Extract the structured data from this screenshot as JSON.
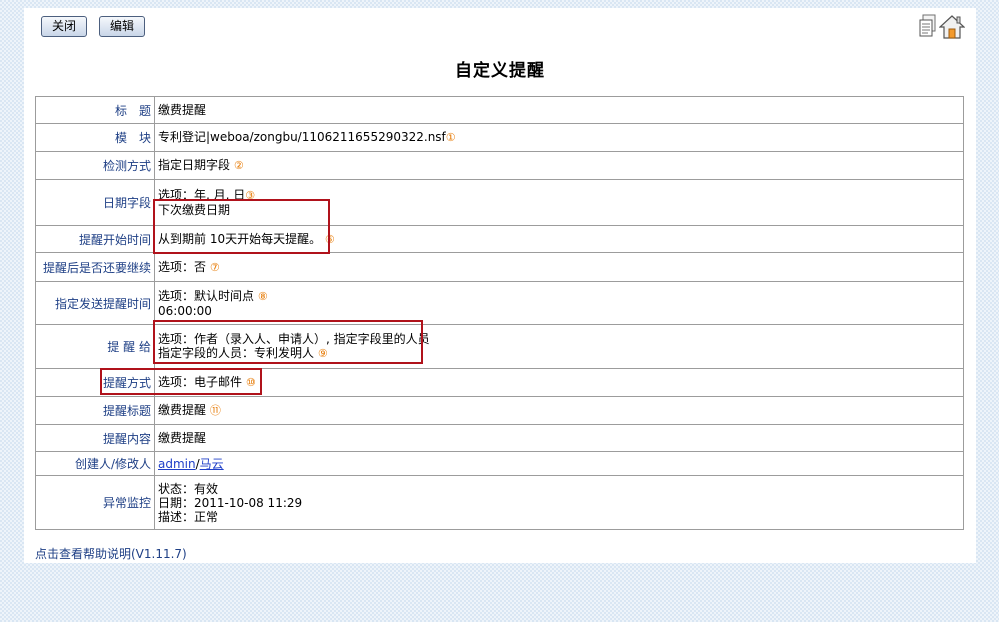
{
  "toolbar": {
    "close_label": "关闭",
    "edit_label": "编辑"
  },
  "page_title": "自定义提醒",
  "rows": {
    "title": {
      "label": "标　题",
      "value": "缴费提醒"
    },
    "module": {
      "label": "模　块",
      "value": "专利登记|weboa/zongbu/1106211655290322.nsf",
      "num": "①"
    },
    "detect": {
      "label": "检测方式",
      "value": "指定日期字段",
      "num": "②"
    },
    "datefield": {
      "label": "日期字段",
      "line1": "选项：年, 月, 日",
      "num": "③",
      "line2": "下次缴费日期"
    },
    "start": {
      "label": "提醒开始时间",
      "value": "从到期前 10天开始每天提醒。",
      "num": "⑥"
    },
    "continue": {
      "label": "提醒后是否还要继续",
      "value": "选项：否",
      "num": "⑦"
    },
    "sendtime": {
      "label": "指定发送提醒时间",
      "line1": "选项：默认时间点",
      "num": "⑧",
      "line2": "06:00:00"
    },
    "remind_to": {
      "label": "提 醒 给",
      "line1": "选项：作者（录入人、申请人）, 指定字段里的人员",
      "line2": "指定字段的人员：专利发明人",
      "num": "⑨"
    },
    "method": {
      "label": "提醒方式",
      "value": "选项：电子邮件",
      "num": "⑩"
    },
    "subject": {
      "label": "提醒标题",
      "value": "缴费提醒",
      "num": "⑪"
    },
    "content": {
      "label": "提醒内容",
      "value": "缴费提醒"
    },
    "creator": {
      "label": "创建人/修改人",
      "creator": "admin",
      "separator": "/",
      "modifier": "马云"
    },
    "monitor": {
      "label": "异常监控",
      "line1": "状态：有效",
      "line2": "日期：2011-10-08 11:29",
      "line3": "描述：正常"
    }
  },
  "footer": {
    "help_link": "点击查看帮助说明(V1.11.7)"
  },
  "colors": {
    "label": "#1e3f85",
    "marker": "#e67800",
    "highlight": "#b0121b",
    "link": "#1f3fc8"
  },
  "icons": [
    "document-icon",
    "home-icon"
  ]
}
